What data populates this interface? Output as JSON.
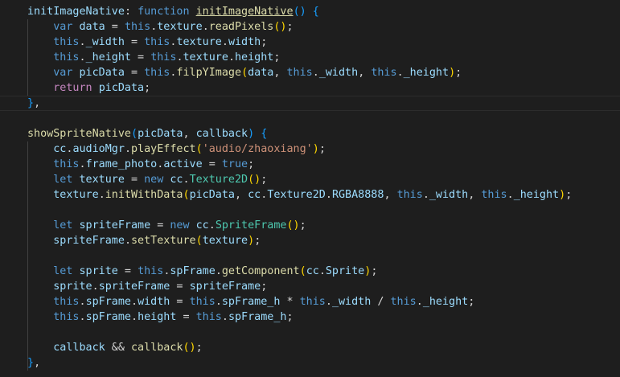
{
  "editor": {
    "theme": {
      "background": "#1e1e1e",
      "keyword": "#569cd6",
      "control": "#c586c0",
      "function": "#dcdcaa",
      "variable": "#9cdcfe",
      "class": "#4ec9b0",
      "string": "#ce9178",
      "bracket_level1": "#ffd700",
      "bracket_level2": "#da70d6",
      "bracket_level3": "#179fff"
    },
    "lines": [
      [
        {
          "text": "initImageNative",
          "c": "var"
        },
        {
          "text": ": ",
          "c": "pun"
        },
        {
          "text": "function",
          "c": "kw"
        },
        {
          "text": " ",
          "c": "pun"
        },
        {
          "text": "initImageNative",
          "c": "fn uline"
        },
        {
          "text": "()",
          "c": "br3"
        },
        {
          "text": " ",
          "c": "pun"
        },
        {
          "text": "{",
          "c": "br3"
        }
      ],
      [
        {
          "text": "    ",
          "c": "pun"
        },
        {
          "text": "var",
          "c": "kw"
        },
        {
          "text": " ",
          "c": "pun"
        },
        {
          "text": "data",
          "c": "var"
        },
        {
          "text": " = ",
          "c": "pun"
        },
        {
          "text": "this",
          "c": "kw"
        },
        {
          "text": ".",
          "c": "pun"
        },
        {
          "text": "texture",
          "c": "var"
        },
        {
          "text": ".",
          "c": "pun"
        },
        {
          "text": "readPixels",
          "c": "fn"
        },
        {
          "text": "()",
          "c": "br1"
        },
        {
          "text": ";",
          "c": "pun"
        }
      ],
      [
        {
          "text": "    ",
          "c": "pun"
        },
        {
          "text": "this",
          "c": "kw"
        },
        {
          "text": ".",
          "c": "pun"
        },
        {
          "text": "_width",
          "c": "var"
        },
        {
          "text": " = ",
          "c": "pun"
        },
        {
          "text": "this",
          "c": "kw"
        },
        {
          "text": ".",
          "c": "pun"
        },
        {
          "text": "texture",
          "c": "var"
        },
        {
          "text": ".",
          "c": "pun"
        },
        {
          "text": "width",
          "c": "var"
        },
        {
          "text": ";",
          "c": "pun"
        }
      ],
      [
        {
          "text": "    ",
          "c": "pun"
        },
        {
          "text": "this",
          "c": "kw"
        },
        {
          "text": ".",
          "c": "pun"
        },
        {
          "text": "_height",
          "c": "var"
        },
        {
          "text": " = ",
          "c": "pun"
        },
        {
          "text": "this",
          "c": "kw"
        },
        {
          "text": ".",
          "c": "pun"
        },
        {
          "text": "texture",
          "c": "var"
        },
        {
          "text": ".",
          "c": "pun"
        },
        {
          "text": "height",
          "c": "var"
        },
        {
          "text": ";",
          "c": "pun"
        }
      ],
      [
        {
          "text": "    ",
          "c": "pun"
        },
        {
          "text": "var",
          "c": "kw"
        },
        {
          "text": " ",
          "c": "pun"
        },
        {
          "text": "picData",
          "c": "var"
        },
        {
          "text": " = ",
          "c": "pun"
        },
        {
          "text": "this",
          "c": "kw"
        },
        {
          "text": ".",
          "c": "pun"
        },
        {
          "text": "filpYImage",
          "c": "fn"
        },
        {
          "text": "(",
          "c": "br1"
        },
        {
          "text": "data",
          "c": "var"
        },
        {
          "text": ", ",
          "c": "pun"
        },
        {
          "text": "this",
          "c": "kw"
        },
        {
          "text": ".",
          "c": "pun"
        },
        {
          "text": "_width",
          "c": "var"
        },
        {
          "text": ", ",
          "c": "pun"
        },
        {
          "text": "this",
          "c": "kw"
        },
        {
          "text": ".",
          "c": "pun"
        },
        {
          "text": "_height",
          "c": "var"
        },
        {
          "text": ")",
          "c": "br1"
        },
        {
          "text": ";",
          "c": "pun"
        }
      ],
      [
        {
          "text": "    ",
          "c": "pun"
        },
        {
          "text": "return",
          "c": "ctrl"
        },
        {
          "text": " ",
          "c": "pun"
        },
        {
          "text": "picData",
          "c": "var"
        },
        {
          "text": ";",
          "c": "pun"
        }
      ],
      [
        {
          "text": "}",
          "c": "br3"
        },
        {
          "text": ",",
          "c": "pun"
        }
      ],
      [],
      [
        {
          "text": "showSpriteNative",
          "c": "fn"
        },
        {
          "text": "(",
          "c": "br3"
        },
        {
          "text": "picData",
          "c": "var"
        },
        {
          "text": ", ",
          "c": "pun"
        },
        {
          "text": "callback",
          "c": "var"
        },
        {
          "text": ")",
          "c": "br3"
        },
        {
          "text": " ",
          "c": "pun"
        },
        {
          "text": "{",
          "c": "br3"
        }
      ],
      [
        {
          "text": "    ",
          "c": "pun"
        },
        {
          "text": "cc",
          "c": "var"
        },
        {
          "text": ".",
          "c": "pun"
        },
        {
          "text": "audioMgr",
          "c": "var"
        },
        {
          "text": ".",
          "c": "pun"
        },
        {
          "text": "playEffect",
          "c": "fn"
        },
        {
          "text": "(",
          "c": "br1"
        },
        {
          "text": "'audio/zhaoxiang'",
          "c": "str"
        },
        {
          "text": ")",
          "c": "br1"
        },
        {
          "text": ";",
          "c": "pun"
        }
      ],
      [
        {
          "text": "    ",
          "c": "pun"
        },
        {
          "text": "this",
          "c": "kw"
        },
        {
          "text": ".",
          "c": "pun"
        },
        {
          "text": "frame_photo",
          "c": "var"
        },
        {
          "text": ".",
          "c": "pun"
        },
        {
          "text": "active",
          "c": "var"
        },
        {
          "text": " = ",
          "c": "pun"
        },
        {
          "text": "true",
          "c": "kw"
        },
        {
          "text": ";",
          "c": "pun"
        }
      ],
      [
        {
          "text": "    ",
          "c": "pun"
        },
        {
          "text": "let",
          "c": "kw"
        },
        {
          "text": " ",
          "c": "pun"
        },
        {
          "text": "texture",
          "c": "var"
        },
        {
          "text": " = ",
          "c": "pun"
        },
        {
          "text": "new",
          "c": "kw"
        },
        {
          "text": " ",
          "c": "pun"
        },
        {
          "text": "cc",
          "c": "var"
        },
        {
          "text": ".",
          "c": "pun"
        },
        {
          "text": "Texture2D",
          "c": "cls"
        },
        {
          "text": "()",
          "c": "br1"
        },
        {
          "text": ";",
          "c": "pun"
        }
      ],
      [
        {
          "text": "    ",
          "c": "pun"
        },
        {
          "text": "texture",
          "c": "var"
        },
        {
          "text": ".",
          "c": "pun"
        },
        {
          "text": "initWithData",
          "c": "fn"
        },
        {
          "text": "(",
          "c": "br1"
        },
        {
          "text": "picData",
          "c": "var"
        },
        {
          "text": ", ",
          "c": "pun"
        },
        {
          "text": "cc",
          "c": "var"
        },
        {
          "text": ".",
          "c": "pun"
        },
        {
          "text": "Texture2D",
          "c": "var"
        },
        {
          "text": ".",
          "c": "pun"
        },
        {
          "text": "RGBA8888",
          "c": "var"
        },
        {
          "text": ", ",
          "c": "pun"
        },
        {
          "text": "this",
          "c": "kw"
        },
        {
          "text": ".",
          "c": "pun"
        },
        {
          "text": "_width",
          "c": "var"
        },
        {
          "text": ", ",
          "c": "pun"
        },
        {
          "text": "this",
          "c": "kw"
        },
        {
          "text": ".",
          "c": "pun"
        },
        {
          "text": "_height",
          "c": "var"
        },
        {
          "text": ")",
          "c": "br1"
        },
        {
          "text": ";",
          "c": "pun"
        }
      ],
      [],
      [
        {
          "text": "    ",
          "c": "pun"
        },
        {
          "text": "let",
          "c": "kw"
        },
        {
          "text": " ",
          "c": "pun"
        },
        {
          "text": "spriteFrame",
          "c": "var"
        },
        {
          "text": " = ",
          "c": "pun"
        },
        {
          "text": "new",
          "c": "kw"
        },
        {
          "text": " ",
          "c": "pun"
        },
        {
          "text": "cc",
          "c": "var"
        },
        {
          "text": ".",
          "c": "pun"
        },
        {
          "text": "SpriteFrame",
          "c": "cls"
        },
        {
          "text": "()",
          "c": "br1"
        },
        {
          "text": ";",
          "c": "pun"
        }
      ],
      [
        {
          "text": "    ",
          "c": "pun"
        },
        {
          "text": "spriteFrame",
          "c": "var"
        },
        {
          "text": ".",
          "c": "pun"
        },
        {
          "text": "setTexture",
          "c": "fn"
        },
        {
          "text": "(",
          "c": "br1"
        },
        {
          "text": "texture",
          "c": "var"
        },
        {
          "text": ")",
          "c": "br1"
        },
        {
          "text": ";",
          "c": "pun"
        }
      ],
      [],
      [
        {
          "text": "    ",
          "c": "pun"
        },
        {
          "text": "let",
          "c": "kw"
        },
        {
          "text": " ",
          "c": "pun"
        },
        {
          "text": "sprite",
          "c": "var"
        },
        {
          "text": " = ",
          "c": "pun"
        },
        {
          "text": "this",
          "c": "kw"
        },
        {
          "text": ".",
          "c": "pun"
        },
        {
          "text": "spFrame",
          "c": "var"
        },
        {
          "text": ".",
          "c": "pun"
        },
        {
          "text": "getComponent",
          "c": "fn"
        },
        {
          "text": "(",
          "c": "br1"
        },
        {
          "text": "cc",
          "c": "var"
        },
        {
          "text": ".",
          "c": "pun"
        },
        {
          "text": "Sprite",
          "c": "var"
        },
        {
          "text": ")",
          "c": "br1"
        },
        {
          "text": ";",
          "c": "pun"
        }
      ],
      [
        {
          "text": "    ",
          "c": "pun"
        },
        {
          "text": "sprite",
          "c": "var"
        },
        {
          "text": ".",
          "c": "pun"
        },
        {
          "text": "spriteFrame",
          "c": "var"
        },
        {
          "text": " = ",
          "c": "pun"
        },
        {
          "text": "spriteFrame",
          "c": "var"
        },
        {
          "text": ";",
          "c": "pun"
        }
      ],
      [
        {
          "text": "    ",
          "c": "pun"
        },
        {
          "text": "this",
          "c": "kw"
        },
        {
          "text": ".",
          "c": "pun"
        },
        {
          "text": "spFrame",
          "c": "var"
        },
        {
          "text": ".",
          "c": "pun"
        },
        {
          "text": "width",
          "c": "var"
        },
        {
          "text": " = ",
          "c": "pun"
        },
        {
          "text": "this",
          "c": "kw"
        },
        {
          "text": ".",
          "c": "pun"
        },
        {
          "text": "spFrame_h",
          "c": "var"
        },
        {
          "text": " * ",
          "c": "pun"
        },
        {
          "text": "this",
          "c": "kw"
        },
        {
          "text": ".",
          "c": "pun"
        },
        {
          "text": "_width",
          "c": "var"
        },
        {
          "text": " / ",
          "c": "pun"
        },
        {
          "text": "this",
          "c": "kw"
        },
        {
          "text": ".",
          "c": "pun"
        },
        {
          "text": "_height",
          "c": "var"
        },
        {
          "text": ";",
          "c": "pun"
        }
      ],
      [
        {
          "text": "    ",
          "c": "pun"
        },
        {
          "text": "this",
          "c": "kw"
        },
        {
          "text": ".",
          "c": "pun"
        },
        {
          "text": "spFrame",
          "c": "var"
        },
        {
          "text": ".",
          "c": "pun"
        },
        {
          "text": "height",
          "c": "var"
        },
        {
          "text": " = ",
          "c": "pun"
        },
        {
          "text": "this",
          "c": "kw"
        },
        {
          "text": ".",
          "c": "pun"
        },
        {
          "text": "spFrame_h",
          "c": "var"
        },
        {
          "text": ";",
          "c": "pun"
        }
      ],
      [],
      [
        {
          "text": "    ",
          "c": "pun"
        },
        {
          "text": "callback",
          "c": "var"
        },
        {
          "text": " && ",
          "c": "pun"
        },
        {
          "text": "callback",
          "c": "fn"
        },
        {
          "text": "()",
          "c": "br1"
        },
        {
          "text": ";",
          "c": "pun"
        }
      ],
      [
        {
          "text": "}",
          "c": "br3"
        },
        {
          "text": ",",
          "c": "pun"
        }
      ]
    ]
  }
}
